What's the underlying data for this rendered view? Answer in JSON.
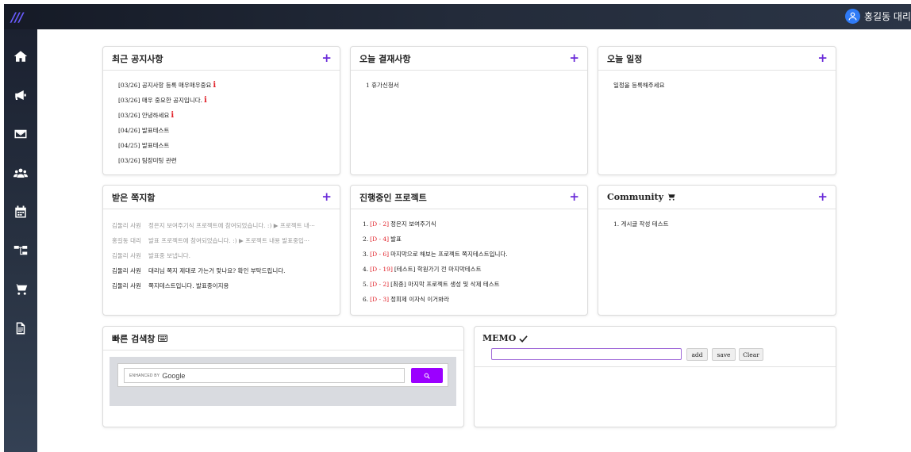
{
  "app": {
    "logo": "/// ",
    "user_name": "홍길동 대리"
  },
  "sidebar": {
    "items": [
      {
        "icon": "home-icon"
      },
      {
        "icon": "megaphone-icon"
      },
      {
        "icon": "envelope-icon"
      },
      {
        "icon": "users-icon"
      },
      {
        "icon": "calendar-icon"
      },
      {
        "icon": "sitemap-icon"
      },
      {
        "icon": "cart-icon"
      },
      {
        "icon": "file-icon"
      }
    ]
  },
  "notices": {
    "title": "최근 공지사항",
    "add": "+",
    "items": [
      {
        "text": "[03/26] 공지사항 등록 매우매우중요",
        "important": true
      },
      {
        "text": "[03/26] 매우 중요한 공지입니다.",
        "important": true
      },
      {
        "text": "[03/26] 안녕하세요",
        "important": true
      },
      {
        "text": "[04/26] 발표테스트",
        "important": false
      },
      {
        "text": "[04/25] 발표테스트",
        "important": false
      },
      {
        "text": "[03/26] 팀장미팅 관련",
        "important": false
      }
    ]
  },
  "approvals": {
    "title": "오늘 결재사항",
    "add": "+",
    "items": [
      "1 휴가신청서"
    ]
  },
  "schedule": {
    "title": "오늘 일정",
    "add": "+",
    "empty": "일정을 등록해주세요"
  },
  "messages": {
    "title": "받은 쪽지함",
    "add": "+",
    "items": [
      {
        "sender": "김둘리 사원",
        "text": "정은지 보여주기식 프로젝트에 참여되었습니다. :) ▶ 프로젝트 내···",
        "read": true
      },
      {
        "sender": "홍길동 대리",
        "text": "발표 프로젝트에 참여되었습니다. :) ▶ 프로젝트 내용 발표중입···",
        "read": true
      },
      {
        "sender": "김둘리 사원",
        "text": "발표중 보냅니다.",
        "read": true
      },
      {
        "sender": "김둘리 사원",
        "text": "대리님 쪽지 제대로 가는거 맞나요? 확인 부탁드립니다.",
        "read": false
      },
      {
        "sender": "김둘리 사원",
        "text": "쪽지테스트입니다. 발표중이지용",
        "read": false
      }
    ]
  },
  "projects": {
    "title": "진행중인 프로젝트",
    "add": "+",
    "items": [
      {
        "num": "1.",
        "dday": "[D - 2]",
        "name": "정은지 보여주기식"
      },
      {
        "num": "2.",
        "dday": "[D - 4]",
        "name": "발표"
      },
      {
        "num": "3.",
        "dday": "[D - 6]",
        "name": "마지막으로 해보는 프로젝트 쪽지테스트입니다."
      },
      {
        "num": "4.",
        "dday": "[D - 19]",
        "name": "[테스트] 학원가기 전 마지막테스트"
      },
      {
        "num": "5.",
        "dday": "[D - 2]",
        "name": "[최종] 마지막 프로젝트 생성 및 삭제 테스트"
      },
      {
        "num": "6.",
        "dday": "[D - 3]",
        "name": "정희제 이자식 이거봐라"
      }
    ]
  },
  "community": {
    "title": "Community",
    "icon": "cart-icon",
    "add": "+",
    "items": [
      "1. 게시글 작성 테스트"
    ]
  },
  "quick_search": {
    "title": "빠른 검색창",
    "icon": "keyboard-icon",
    "enhanced": "ENHANCED BY",
    "google": "Google",
    "button_icon": "search-icon"
  },
  "memo": {
    "title": "MEMO",
    "icon": "check-icon",
    "input_value": "",
    "add_label": "add",
    "save_label": "save",
    "clear_label": "Clear"
  },
  "colors": {
    "accent": "#6a2bd9",
    "search_button": "#9b00ff",
    "important": "#e0222a",
    "user_avatar": "#2f7bf6"
  }
}
